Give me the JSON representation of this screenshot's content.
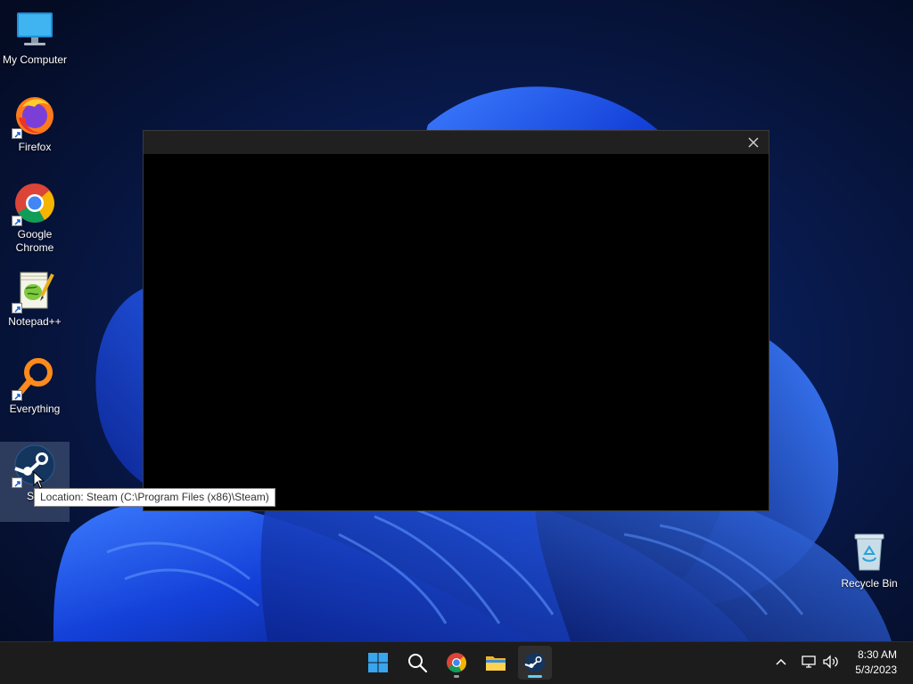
{
  "desktop": {
    "icons": [
      {
        "name": "my-computer",
        "label": "My Computer"
      },
      {
        "name": "firefox",
        "label": "Firefox"
      },
      {
        "name": "google-chrome",
        "label": "Google Chrome"
      },
      {
        "name": "notepad-plus-plus",
        "label": "Notepad++"
      },
      {
        "name": "everything",
        "label": "Everything"
      },
      {
        "name": "steam",
        "label": "Steam",
        "visible_label": "Ste"
      },
      {
        "name": "recycle-bin",
        "label": "Recycle Bin"
      }
    ]
  },
  "tooltip": {
    "text": "Location: Steam (C:\\Program Files (x86)\\Steam)"
  },
  "splash": {
    "close_icon": "close-icon",
    "content": "black-loading-area"
  },
  "taskbar": {
    "pinned": [
      {
        "name": "start",
        "icon": "windows-start-icon"
      },
      {
        "name": "search",
        "icon": "search-icon"
      },
      {
        "name": "chrome",
        "icon": "chrome-icon",
        "running": true
      },
      {
        "name": "file-explorer",
        "icon": "folder-icon"
      },
      {
        "name": "steam",
        "icon": "steam-icon",
        "running": true,
        "active": true
      }
    ],
    "tray": [
      "chevron-up-icon",
      "network-icon",
      "volume-icon"
    ],
    "clock": {
      "time": "8:30 AM",
      "date": "5/3/2023"
    }
  },
  "colors": {
    "accent": "#60cdff",
    "taskbar": "#1c1c1c",
    "wallpaper_blue": "#1a5cff"
  }
}
